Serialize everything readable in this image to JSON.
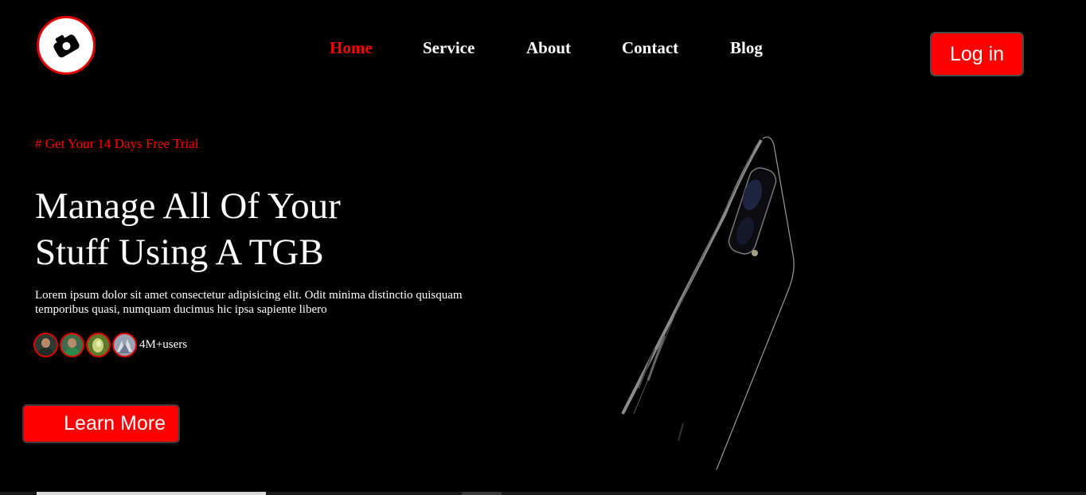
{
  "nav": {
    "items": [
      {
        "label": "Home",
        "active": true
      },
      {
        "label": "Service",
        "active": false
      },
      {
        "label": "About",
        "active": false
      },
      {
        "label": "Contact",
        "active": false
      },
      {
        "label": "Blog",
        "active": false
      }
    ],
    "login_label": "Log in"
  },
  "logo": {
    "icon": "camera-icon"
  },
  "hero": {
    "trial_text": "# Get Your 14 Days Free Trial",
    "headline_line1": "Manage All Of Your",
    "headline_line2": "Stuff Using A TGB",
    "description_line1": "Lorem ipsum dolor sit amet consectetur adipisicing elit. Odit minima distinctio quisquam",
    "description_line2": "temporibus quasi, numquam ducimus hic ipsa sapiente libero",
    "users_count": "4M+users",
    "cta_label": "Learn More"
  },
  "colors": {
    "accent": "#ff0000",
    "background": "#000000",
    "text": "#ffffff"
  }
}
